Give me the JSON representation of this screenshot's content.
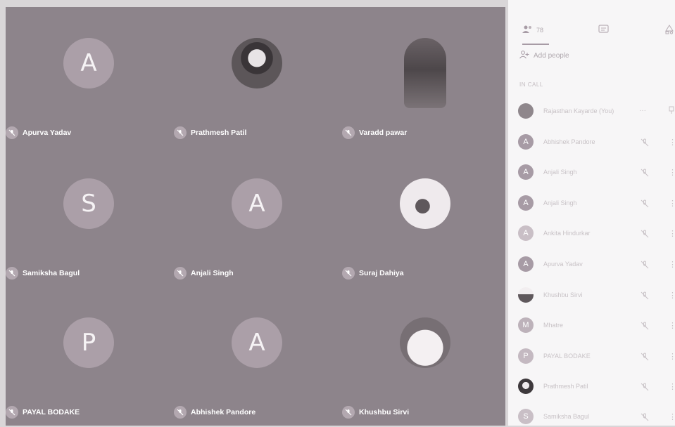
{
  "tiles": [
    {
      "name": "Apurva Yadav",
      "initial": "A",
      "avatar": "letter"
    },
    {
      "name": "Prathmesh Patil",
      "initial": "",
      "avatar": "photo-dark"
    },
    {
      "name": "Varadd pawar",
      "initial": "",
      "avatar": "statue"
    },
    {
      "name": "Samiksha Bagul",
      "initial": "S",
      "avatar": "letter"
    },
    {
      "name": "Anjali Singh",
      "initial": "A",
      "avatar": "letter"
    },
    {
      "name": "Suraj Dahiya",
      "initial": "",
      "avatar": "photo-light"
    },
    {
      "name": "PAYAL BODAKE",
      "initial": "P",
      "avatar": "letter"
    },
    {
      "name": "Abhishek Pandore",
      "initial": "A",
      "avatar": "letter"
    },
    {
      "name": "Khushbu Sirvi",
      "initial": "",
      "avatar": "photo-soft"
    }
  ],
  "panel": {
    "tabs": [
      {
        "icon": "people-icon",
        "label": "78"
      },
      {
        "icon": "chat-icon",
        "label": ""
      },
      {
        "icon": "activities-icon",
        "label": ""
      }
    ],
    "add_people": "Add people",
    "section": "IN CALL",
    "participants": [
      {
        "name": "Rajasthan Kayarde (You)",
        "initial": "",
        "more": "···"
      },
      {
        "name": "Abhishek Pandore",
        "initial": "A"
      },
      {
        "name": "Anjali Singh",
        "initial": "A"
      },
      {
        "name": "Anjali Singh",
        "initial": "A"
      },
      {
        "name": "Ankita Hindurkar",
        "initial": "A"
      },
      {
        "name": "Apurva Yadav",
        "initial": "A"
      },
      {
        "name": "Khushbu Sirvi",
        "initial": ""
      },
      {
        "name": "Mhatre",
        "initial": "M"
      },
      {
        "name": "PAYAL BODAKE",
        "initial": "P"
      },
      {
        "name": "Prathmesh Patil",
        "initial": ""
      },
      {
        "name": "Samiksha Bagul",
        "initial": "S"
      }
    ]
  },
  "colors": {
    "grid_bg": "#8d848b",
    "tile_avatar": "#ab9fa8",
    "panel_bg": "#f7f6f7"
  }
}
